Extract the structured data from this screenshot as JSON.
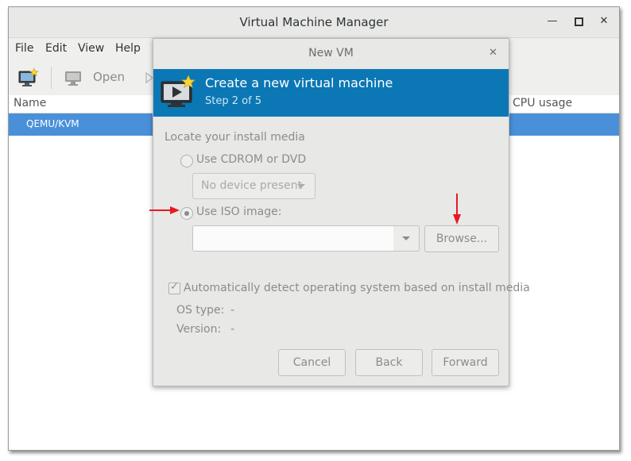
{
  "main_window": {
    "title": "Virtual Machine Manager",
    "menu": [
      "File",
      "Edit",
      "View",
      "Help"
    ],
    "toolbar": {
      "open_label": "Open"
    },
    "columns": {
      "name": "Name",
      "cpu_usage": "CPU usage"
    },
    "connections": [
      "QEMU/KVM"
    ]
  },
  "dialog": {
    "title": "New VM",
    "banner_title": "Create a new virtual machine",
    "banner_step": "Step 2 of 5",
    "section_label": "Locate your install media",
    "option_cdrom": "Use CDROM or DVD",
    "device_combo": "No device present",
    "option_iso": "Use ISO image:",
    "iso_value": "",
    "browse_button": "Browse...",
    "auto_detect": "Automatically detect operating system based on install media",
    "auto_detect_checked": true,
    "os_type_label": "OS type:",
    "os_type_value": "-",
    "version_label": "Version:",
    "version_value": "-",
    "buttons": {
      "cancel": "Cancel",
      "back": "Back",
      "forward": "Forward"
    }
  },
  "annotation_color": "#e8191f",
  "accent_color": "#0b77b4",
  "selection_color": "#4a90d9"
}
